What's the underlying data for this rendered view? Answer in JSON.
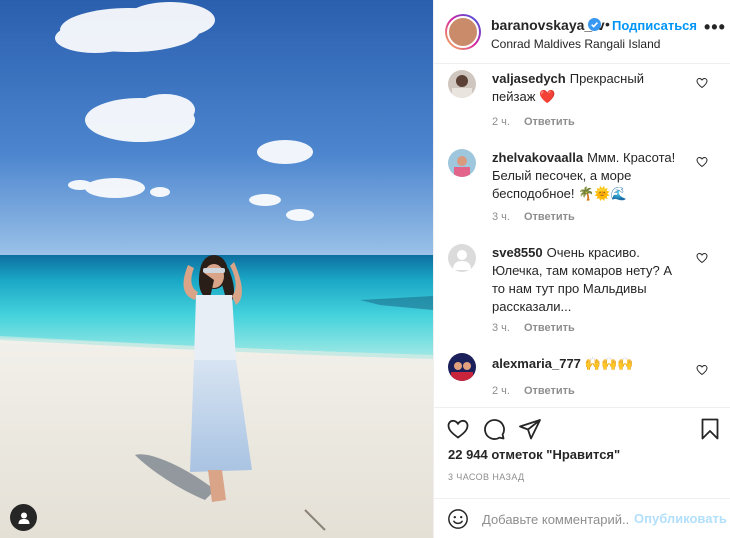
{
  "post": {
    "username": "baranovskaya_tv",
    "dot": "•",
    "follow_label": "Подписаться",
    "location": "Conrad Maldives Rangali Island",
    "more_label": "•••"
  },
  "comments": [
    {
      "username": "valjasedych",
      "text": "Прекрасный пейзаж ❤️",
      "time": "2 ч.",
      "reply": "Ответить"
    },
    {
      "username": "zhelvakovaalla",
      "text": "Ммм. Красота! Белый песочек, а море бесподобное! 🌴🌞🌊",
      "time": "3 ч.",
      "reply": "Ответить"
    },
    {
      "username": "sve8550",
      "text": "Очень красиво. Юлечка, там комаров нету? А то нам тут про Мальдивы рассказали...",
      "time": "3 ч.",
      "reply": "Ответить"
    },
    {
      "username": "alexmaria_777",
      "text": "🙌🙌🙌",
      "time": "2 ч.",
      "reply": "Ответить"
    }
  ],
  "actions": {
    "likes": "22 944 отметок \"Нравится\"",
    "time_ago": "3 ЧАСОВ НАЗАД"
  },
  "add_comment": {
    "placeholder": "Добавьте комментарий...",
    "publish_label": "Опубликовать"
  },
  "colors": {
    "accent": "#0095f6",
    "publish_disabled": "#b2dffc",
    "muted": "#8e8e8e",
    "text": "#262626"
  }
}
